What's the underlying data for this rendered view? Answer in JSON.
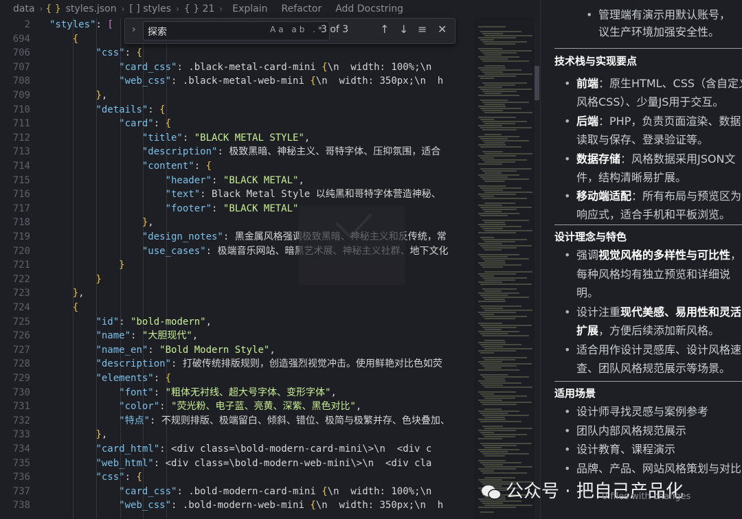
{
  "breadcrumb": {
    "folder": "data",
    "file": "styles.json",
    "arr": "[ ] styles",
    "obj": "{ } 21",
    "lens": [
      "Explain",
      "Refactor",
      "Add Docstring"
    ]
  },
  "find": {
    "value": "探索",
    "count": "3 of 3",
    "opts": "Aa ab .*"
  },
  "code": [
    {
      "n": "2",
      "t": "    \"styles\": ["
    },
    {
      "n": "694",
      "t": "        {"
    },
    {
      "n": "706",
      "t": "            \"css\": {"
    },
    {
      "n": "707",
      "t": "                \"card_css\": \".black-metal-card-mini {\\n  width: 100%;\\n"
    },
    {
      "n": "708",
      "t": "                \"web_css\": \".black-metal-web-mini {\\n  width: 350px;\\n  h"
    },
    {
      "n": "709",
      "t": "            },"
    },
    {
      "n": "710",
      "t": "            \"details\": {"
    },
    {
      "n": "711",
      "t": "                \"card\": {"
    },
    {
      "n": "712",
      "t": "                    \"title\": \"BLACK METAL STYLE\","
    },
    {
      "n": "713",
      "t": "                    \"description\": \"极致黑暗、神秘主义、哥特字体、压抑氛围，适合"
    },
    {
      "n": "714",
      "t": "                    \"content\": {"
    },
    {
      "n": "715",
      "t": "                        \"header\": \"BLACK METAL\","
    },
    {
      "n": "716",
      "t": "                        \"text\": \"Black Metal Style 以纯黑和哥特字体营造神秘、"
    },
    {
      "n": "717",
      "t": "                        \"footer\": \"BLACK METAL\""
    },
    {
      "n": "718",
      "t": "                    },"
    },
    {
      "n": "719",
      "t": "                    \"design_notes\": \"黑金属风格强调极致黑暗、神秘主义和反传统，常"
    },
    {
      "n": "720",
      "t": "                    \"use_cases\": \"极端音乐网站、暗黑艺术展、神秘主义社群、地下文化"
    },
    {
      "n": "721",
      "t": "                }"
    },
    {
      "n": "722",
      "t": "            }"
    },
    {
      "n": "723",
      "t": "        },"
    },
    {
      "n": "724",
      "t": "        {"
    },
    {
      "n": "725",
      "t": "            \"id\": \"bold-modern\","
    },
    {
      "n": "726",
      "t": "            \"name\": \"大胆现代\","
    },
    {
      "n": "727",
      "t": "            \"name_en\": \"Bold Modern Style\","
    },
    {
      "n": "728",
      "t": "            \"description\": \"打破传统排版规则，创造强烈视觉冲击。使用鲜艳对比色如荧"
    },
    {
      "n": "729",
      "t": "            \"elements\": {"
    },
    {
      "n": "730",
      "t": "                \"font\": \"粗体无衬线、超大号字体、变形字体\","
    },
    {
      "n": "731",
      "t": "                \"color\": \"荧光粉、电子蓝、亮黄、深紫、黑色对比\","
    },
    {
      "n": "732",
      "t": "                \"特点\": \"不规则排版、极端留白、倾斜、错位、极简与极繁并存、色块叠加、"
    },
    {
      "n": "733",
      "t": "            },"
    },
    {
      "n": "734",
      "t": "            \"card_html\": \"<div class=\\\"bold-modern-card-mini\\\">\\n  <div c"
    },
    {
      "n": "735",
      "t": "            \"web_html\": \"<div class=\\\"bold-modern-web-mini\\\">\\n  <div cla"
    },
    {
      "n": "736",
      "t": "            \"css\": {"
    },
    {
      "n": "737",
      "t": "                \"card_css\": \".bold-modern-card-mini {\\n  width: 100%;\\n"
    },
    {
      "n": "738",
      "t": "                \"web_css\": \".bold-modern-web-mini {\\n  width: 350px;\\n  h"
    }
  ],
  "panel": {
    "top_bullet": [
      "管理端有演示用默认账号，",
      "议生产环境加强安全性。"
    ],
    "sections": [
      {
        "title": "技术栈与实现要点",
        "items": [
          {
            "bold": "前端",
            "rest": "：原生HTML、CSS（含自定义",
            "cont": "风格CSS）、少量JS用于交互。"
          },
          {
            "bold": "后端",
            "rest": "：PHP，负责页面渲染、数据",
            "cont": "读取与保存、登录验证等。"
          },
          {
            "bold": "数据存储",
            "rest": "：风格数据采用JSON文",
            "cont": "件，结构清晰易扩展。"
          },
          {
            "bold": "移动端适配",
            "rest": "：所有布局与预览区为",
            "cont": "响应式，适合手机和平板浏览。"
          }
        ]
      },
      {
        "title": "设计理念与特色",
        "items": [
          {
            "pre": "强调",
            "bold": "视觉风格的多样性与可比性",
            "rest": "，",
            "cont": "每种风格均有独立预览和详细说",
            "cont2": "明。"
          },
          {
            "pre": "设计注重",
            "bold": "现代美感、易用性和灵活",
            "rest": "",
            "cont_bold": "扩展",
            "cont": "，方便后续添加新风格。"
          },
          {
            "pre": "适合用作设计灵感库、设计风格速",
            "bold": "",
            "rest": "",
            "cont": "查、团队风格规范展示等场景。"
          }
        ]
      },
      {
        "title": "适用场景",
        "items": [
          {
            "pre": "设计师寻找灵感与案例参考"
          },
          {
            "pre": "团队内部风格规范展示"
          },
          {
            "pre": "设计教育、课程演示"
          },
          {
            "pre": "品牌、产品、网站风格策划与对比"
          }
        ]
      }
    ],
    "changes": "0 files with changes"
  },
  "watermark": {
    "brand": "公众号 · 把自己产品化"
  },
  "colors": {
    "key": "#7cc0ea",
    "string": "#c9ef95",
    "bracket": "#e6c34c",
    "background": "#1e1f24"
  }
}
